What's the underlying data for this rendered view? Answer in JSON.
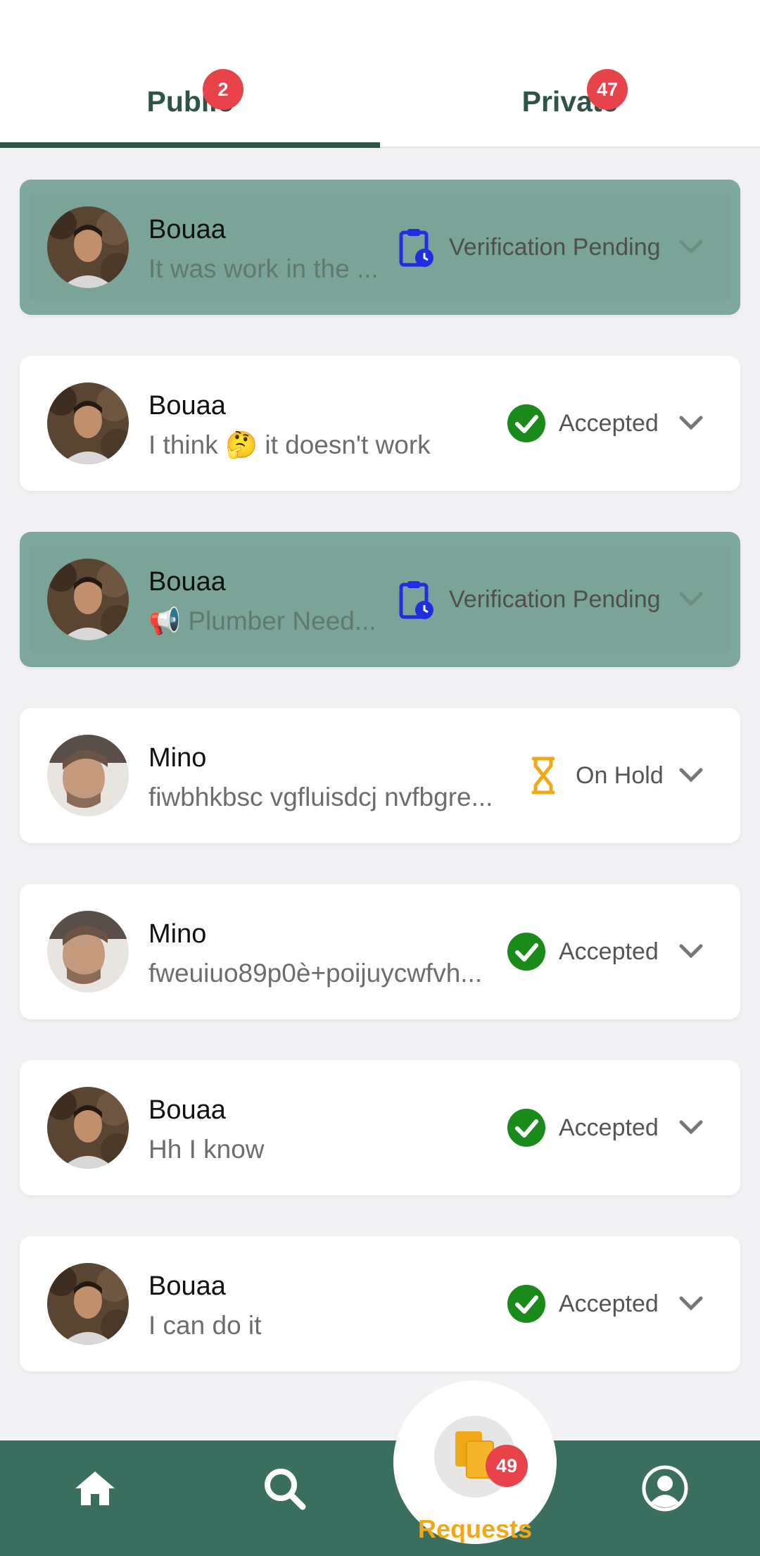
{
  "tabs": [
    {
      "label": "Public",
      "badge": "2"
    },
    {
      "label": "Private",
      "badge": "47"
    }
  ],
  "requests": [
    {
      "name": "Bouaa",
      "message": "It was work in the ...",
      "status": "Verification Pending",
      "status_type": "pending"
    },
    {
      "name": "Bouaa",
      "message": "I think 🤔 it doesn't work",
      "status": "Accepted",
      "status_type": "accepted"
    },
    {
      "name": "Bouaa",
      "message": "📢 Plumber Need...",
      "status": "Verification Pending",
      "status_type": "pending"
    },
    {
      "name": "Mino",
      "message": "fiwbhkbsc vgfluisdcj nvfbgre...",
      "status": "On Hold",
      "status_type": "hold"
    },
    {
      "name": "Mino",
      "message": "fweuiuo89p0è+poijuycwfvh...",
      "status": "Accepted",
      "status_type": "accepted"
    },
    {
      "name": "Bouaa",
      "message": "Hh I know",
      "status": "Accepted",
      "status_type": "accepted"
    },
    {
      "name": "Bouaa",
      "message": "I can do it",
      "status": "Accepted",
      "status_type": "accepted"
    }
  ],
  "bottom_nav": {
    "items": [
      {
        "icon": "home-icon"
      },
      {
        "icon": "search-icon"
      },
      {
        "icon": "requests-icon",
        "label": "Requests",
        "badge": "49"
      },
      {
        "icon": "profile-icon"
      }
    ]
  },
  "colors": {
    "accent": "#2e5446",
    "nav_bg": "#3a6f60",
    "pending_card": "#7ea89c",
    "badge": "#e8424a",
    "accepted": "#1a8a1a",
    "hold": "#f0a818",
    "pending_icon": "#1f2fe0"
  }
}
